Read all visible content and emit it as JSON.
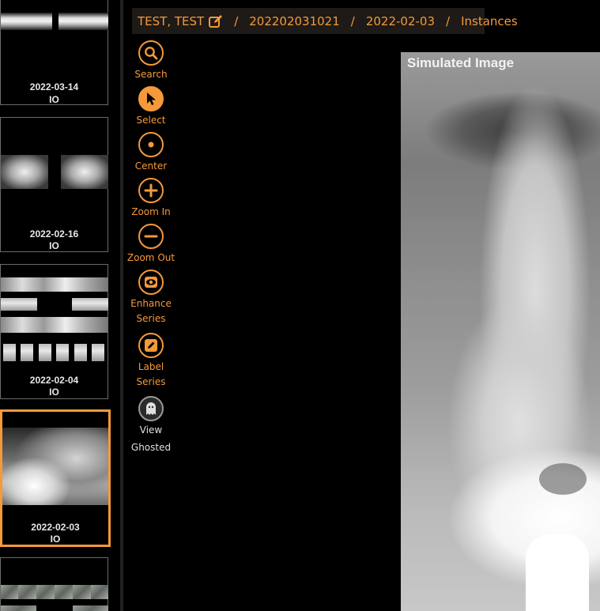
{
  "breadcrumb": {
    "patient": "TEST, TEST",
    "separator": "/",
    "study_id": "202202031021",
    "date": "2022-02-03",
    "current": "Instances"
  },
  "series": [
    {
      "date": "2022-03-14",
      "modality": "IO",
      "selected": false
    },
    {
      "date": "2022-02-16",
      "modality": "IO",
      "selected": false
    },
    {
      "date": "2022-02-04",
      "modality": "IO",
      "selected": false
    },
    {
      "date": "2022-02-03",
      "modality": "IO",
      "selected": true
    }
  ],
  "tools": [
    {
      "icon": "search-icon",
      "label": "Search"
    },
    {
      "icon": "cursor-icon",
      "label": "Select"
    },
    {
      "icon": "center-dot-icon",
      "label": "Center"
    },
    {
      "icon": "plus-icon",
      "label": "Zoom In"
    },
    {
      "icon": "minus-icon",
      "label": "Zoom Out"
    },
    {
      "icon": "eye-icon",
      "label_line1": "Enhance",
      "label_line2": "Series"
    },
    {
      "icon": "edit-icon",
      "label_line1": "Label",
      "label_line2": "Series"
    },
    {
      "icon": "ghost-icon",
      "label_line1": "View",
      "label_line2": "Ghosted"
    }
  ],
  "viewer": {
    "overlay_label": "Simulated Image"
  },
  "colors": {
    "accent": "#f5993b",
    "background": "#000000",
    "breadcrumb_bg": "#1d1a17"
  }
}
